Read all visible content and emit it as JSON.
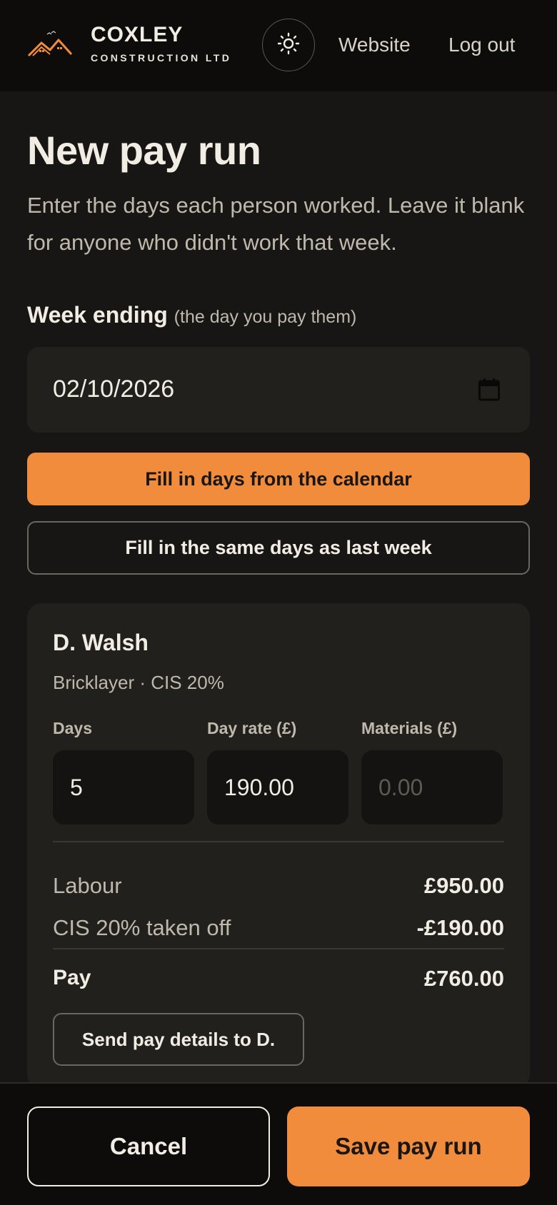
{
  "header": {
    "brand_name": "COXLEY",
    "brand_sub": "CONSTRUCTION LTD",
    "website_label": "Website",
    "logout_label": "Log out"
  },
  "page": {
    "title": "New pay run",
    "intro": "Enter the days each person worked. Leave it blank for anyone who didn't work that week."
  },
  "week": {
    "label": "Week ending",
    "hint": "(the day you pay them)",
    "value": "02/10/2026"
  },
  "actions": {
    "fill_calendar": "Fill in days from the calendar",
    "fill_last_week": "Fill in the same days as last week"
  },
  "worker": {
    "name": "D. Walsh",
    "role": "Bricklayer · CIS 20%",
    "days_label": "Days",
    "rate_label": "Day rate (£)",
    "materials_label": "Materials (£)",
    "days_value": "5",
    "rate_value": "190.00",
    "materials_placeholder": "0.00",
    "labour_label": "Labour",
    "labour_value": "£950.00",
    "cis_label": "CIS 20% taken off",
    "cis_value": "-£190.00",
    "pay_label": "Pay",
    "pay_value": "£760.00",
    "send_label": "Send pay details to D."
  },
  "footer": {
    "cancel_label": "Cancel",
    "save_label": "Save pay run"
  },
  "colors": {
    "accent": "#f08c3c",
    "background": "#181614",
    "header": "#0d0c0b",
    "card": "#22201d"
  }
}
